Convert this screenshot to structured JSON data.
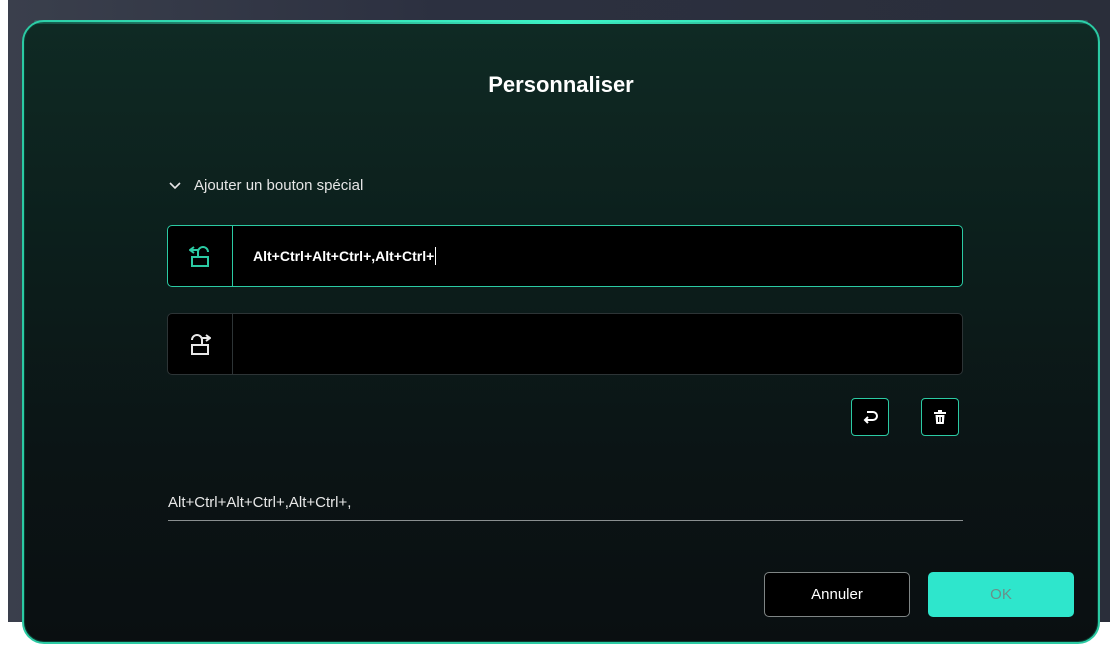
{
  "dialog": {
    "title": "Personnaliser",
    "section_label": "Ajouter un bouton spécial",
    "fields": [
      {
        "icon": "unlock-rotate-left-icon",
        "value": "Alt+Ctrl+Alt+Ctrl+,Alt+Ctrl+"
      },
      {
        "icon": "unlock-rotate-right-icon",
        "value": ""
      }
    ],
    "preview_text": "Alt+Ctrl+Alt+Ctrl+,Alt+Ctrl+,",
    "buttons": {
      "cancel": "Annuler",
      "ok": "OK"
    }
  },
  "colors": {
    "accent": "#2bcaa3",
    "ok_button": "#2ee6cc",
    "field_bg": "#000000"
  }
}
